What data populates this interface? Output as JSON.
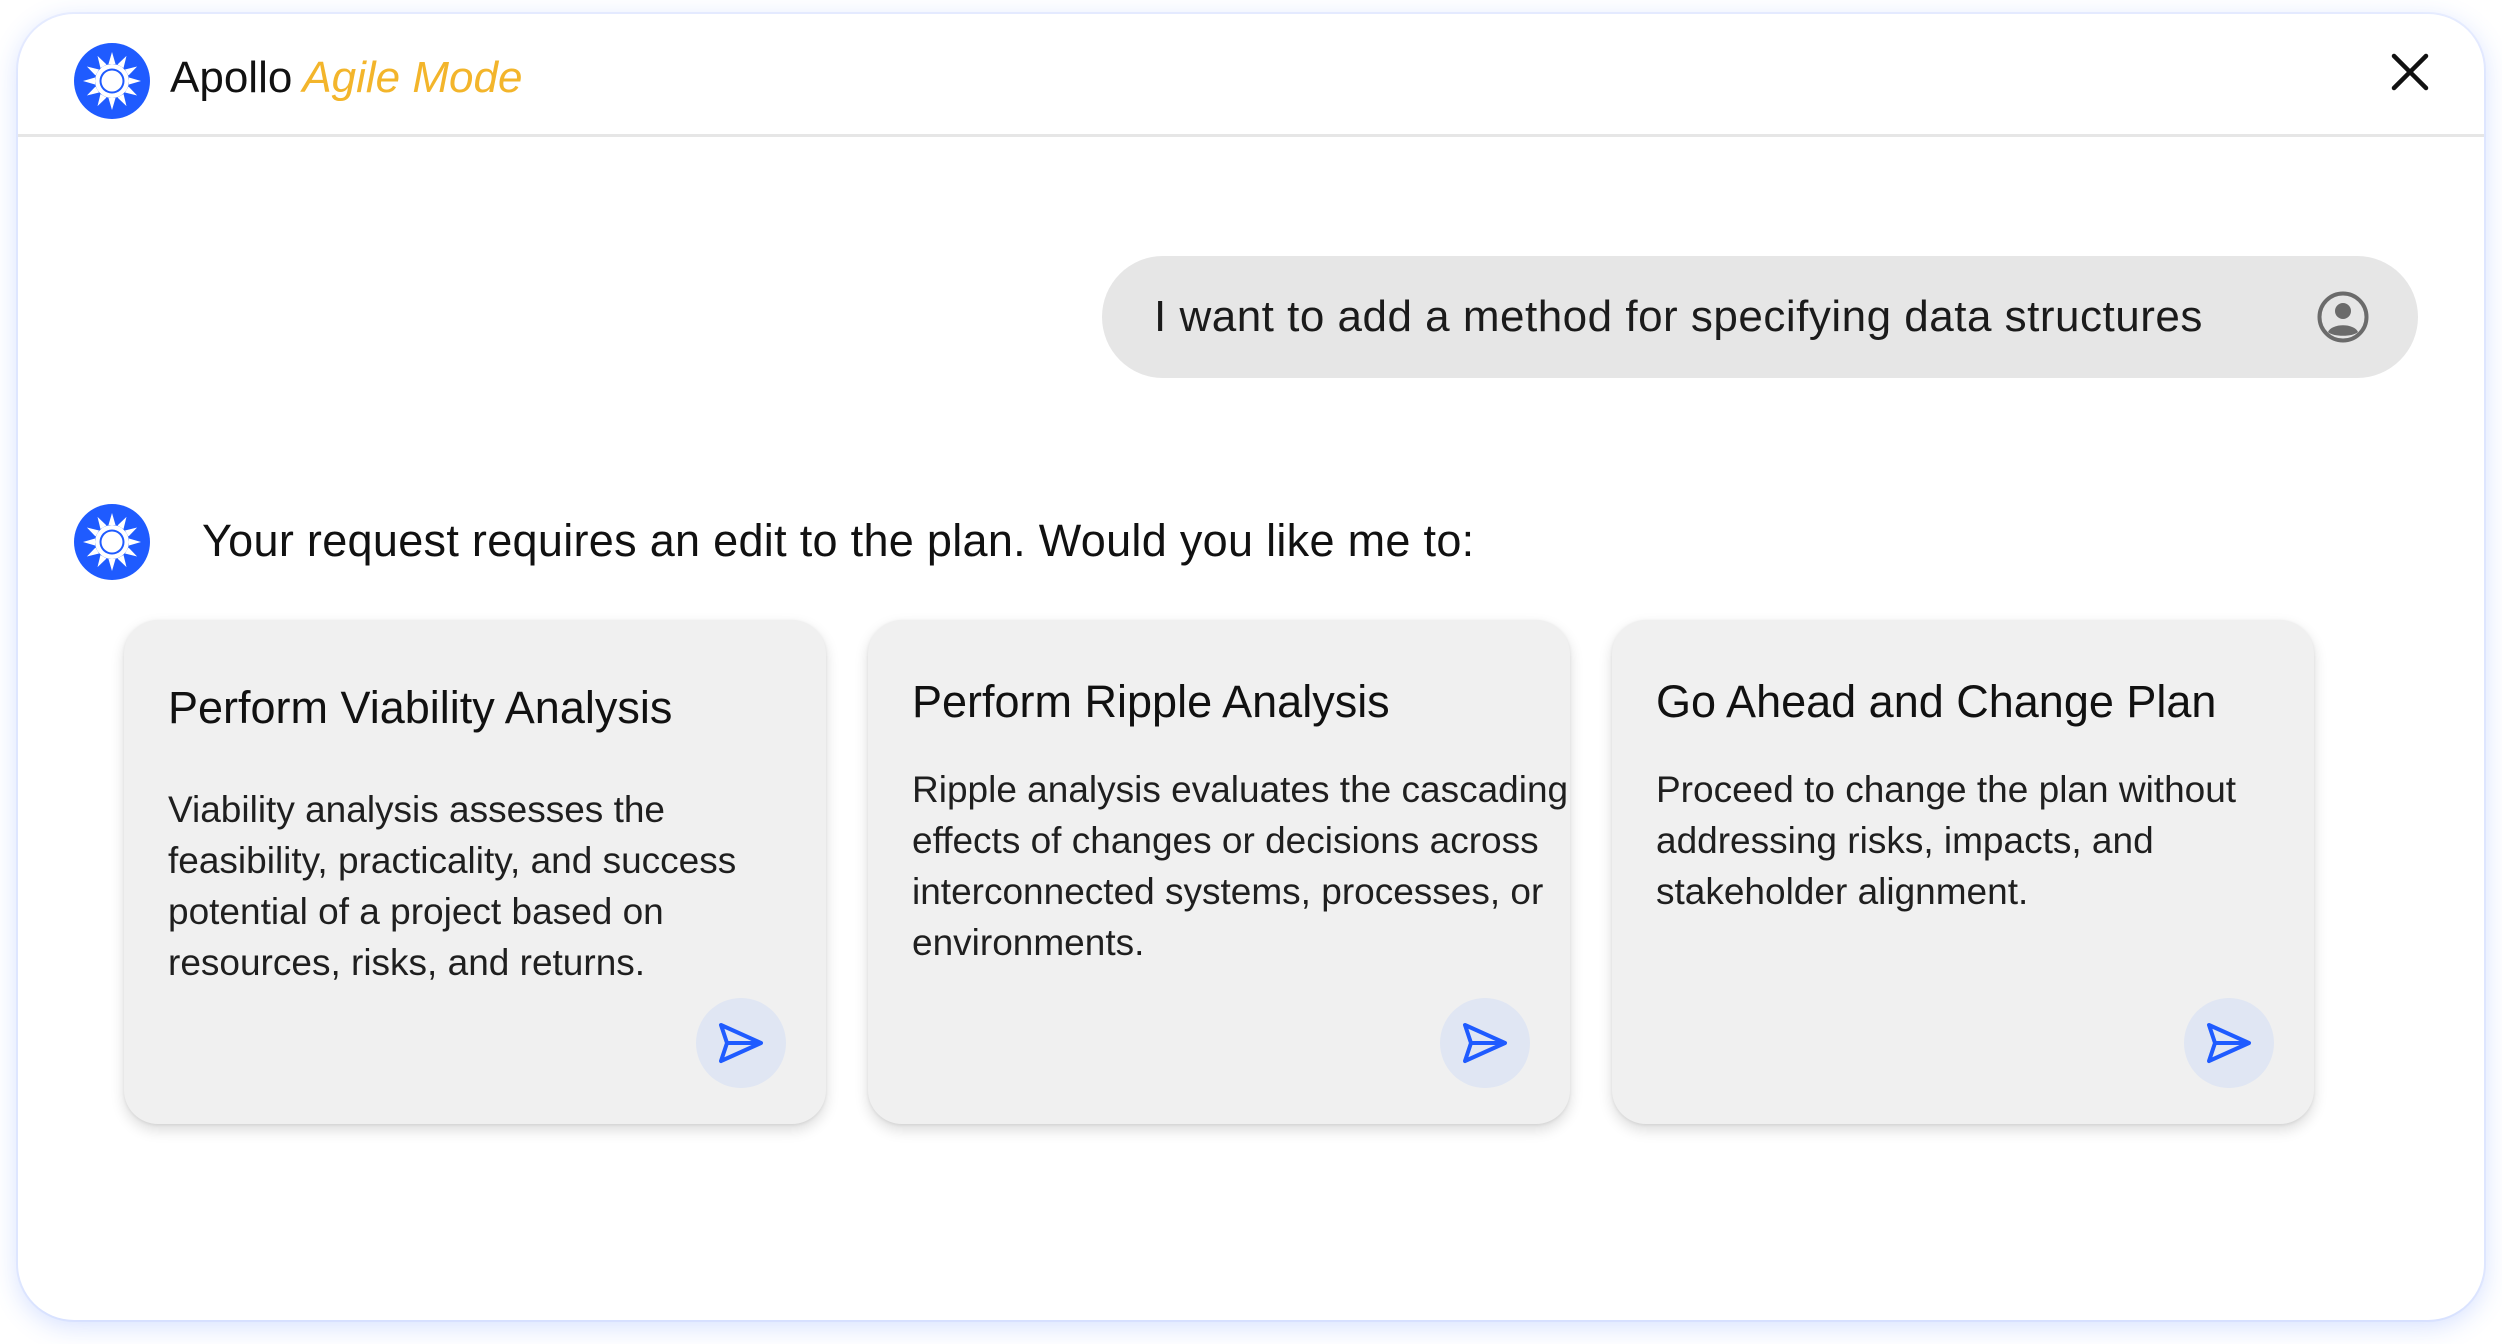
{
  "header": {
    "app_name": "Apollo",
    "mode_label": "Agile Mode",
    "logo_icon": "sun-gear-icon",
    "close_icon": "close-icon"
  },
  "conversation": {
    "user_message": "I want to add a method for specifying data structures",
    "user_icon": "user-avatar-icon",
    "assistant_message": "Your request requires an edit to the plan. Would you like me to:"
  },
  "options": [
    {
      "title": "Perform Viability Analysis",
      "description": "Viability analysis assesses the feasibility, practicality, and success potential of a project based on resources, risks, and returns.",
      "action_icon": "send-icon"
    },
    {
      "title": "Perform Ripple Analysis",
      "description": "Ripple analysis evaluates the cascading effects of changes or decisions across interconnected systems, processes, or environments.",
      "action_icon": "send-icon"
    },
    {
      "title": "Go Ahead and Change Plan",
      "description": "Proceed to change the plan without addressing risks, impacts, and stakeholder alignment.",
      "action_icon": "send-icon"
    }
  ],
  "colors": {
    "accent_blue": "#1f5bff",
    "mode_yellow": "#f3b52b",
    "bubble_gray": "#e6e6e6",
    "card_gray": "#f0f0f0",
    "send_button_bg": "#e0e6f3"
  }
}
